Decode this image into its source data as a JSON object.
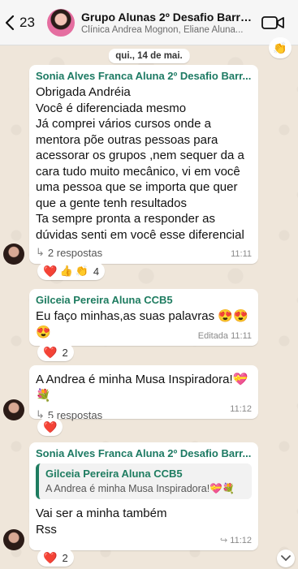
{
  "header": {
    "back_count": "23",
    "title": "Grupo Alunas 2º Desafio Barrig...",
    "subtitle": "Clínica Andrea Mognon, Eliane Aluna..."
  },
  "date_pill": "qui., 14 de mai.",
  "top_reaction": "👏",
  "messages": [
    {
      "sender": "Sonia Alves Franca Aluna 2º Desafio Barr...",
      "lines": [
        "Obrigada Andréia",
        "Você  é diferenciada mesmo",
        "Já comprei vários cursos onde a",
        "mentora põe  outras pessoas para",
        "acessorar  os grupos ,nem sequer da a",
        "cara tudo muito mecânico, vi em você",
        "uma pessoa que se importa que quer",
        "que a gente tenh resultados",
        "Ta sempre pronta a responder as",
        "dúvidas senti em você  esse diferencial"
      ],
      "replies": "2 respostas",
      "time": "11:11",
      "reactions": [
        "❤️",
        "👍",
        "👏"
      ],
      "reaction_count": "4"
    },
    {
      "sender": "Gilceia Pereira Aluna CCB5",
      "text": "Eu faço minhas,as suas palavras 😍😍😍",
      "time": "Editada 11:11",
      "reactions": [
        "❤️"
      ],
      "reaction_count": "2"
    },
    {
      "text": "A Andrea é minha Musa Inspiradora!💝💐",
      "replies": "5 respostas",
      "time": "11:12",
      "reactions": [
        "❤️"
      ]
    },
    {
      "sender": "Sonia Alves Franca Aluna 2º Desafio Barr...",
      "quote_sender": "Gilceia Pereira Aluna CCB5",
      "quote_text": "A Andrea é minha Musa Inspiradora!💝💐",
      "lines": [
        "Vai ser a minha também",
        "Rss"
      ],
      "time": "11:12",
      "reactions": [
        "❤️"
      ],
      "reaction_count": "2"
    }
  ]
}
